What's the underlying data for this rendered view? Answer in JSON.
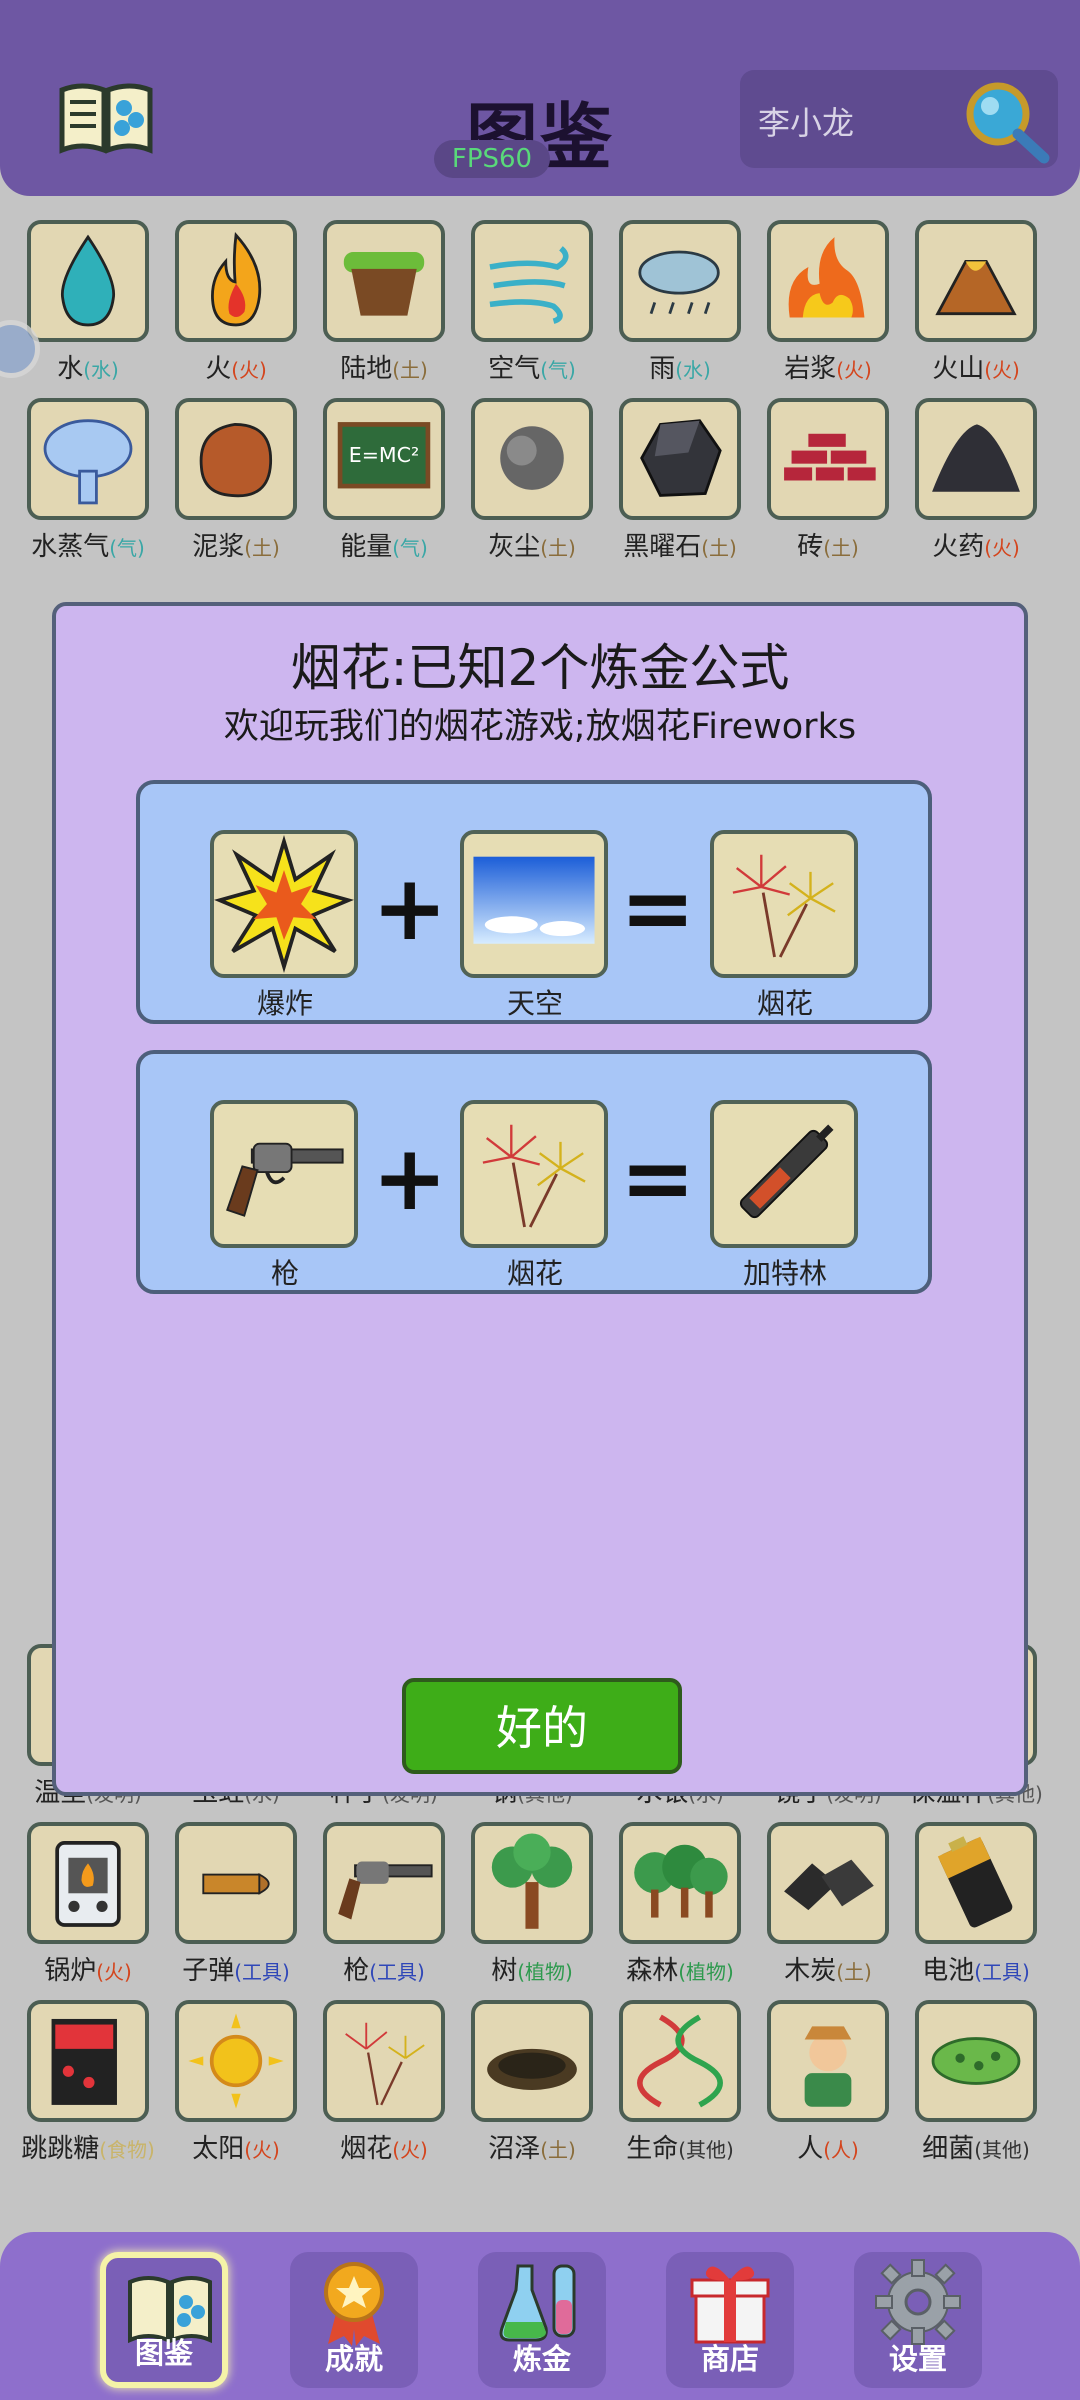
{
  "header": {
    "title": "图鉴",
    "fps": "FPS60",
    "search_text": "李小龙"
  },
  "grid": [
    {
      "name": "水",
      "cat": "水",
      "color": "#3aa7a6",
      "icon": "water-drop-icon"
    },
    {
      "name": "火",
      "cat": "火",
      "color": "#d4451d",
      "icon": "fire-icon"
    },
    {
      "name": "陆地",
      "cat": "土",
      "color": "#8a6d3b",
      "icon": "land-icon"
    },
    {
      "name": "空气",
      "cat": "气",
      "color": "#3aa7a6",
      "icon": "wind-icon"
    },
    {
      "name": "雨",
      "cat": "水",
      "color": "#3aa7a6",
      "icon": "rain-cloud-icon"
    },
    {
      "name": "岩浆",
      "cat": "火",
      "color": "#d4451d",
      "icon": "lava-icon"
    },
    {
      "name": "火山",
      "cat": "火",
      "color": "#d4451d",
      "icon": "volcano-icon"
    },
    {
      "name": "水蒸气",
      "cat": "气",
      "color": "#3aa7a6",
      "icon": "steam-icon"
    },
    {
      "name": "泥浆",
      "cat": "土",
      "color": "#8a6d3b",
      "icon": "mud-icon"
    },
    {
      "name": "能量",
      "cat": "气",
      "color": "#3aa7a6",
      "icon": "energy-board-icon"
    },
    {
      "name": "灰尘",
      "cat": "土",
      "color": "#8a6d3b",
      "icon": "dust-icon"
    },
    {
      "name": "黑曜石",
      "cat": "土",
      "color": "#8a6d3b",
      "icon": "obsidian-icon"
    },
    {
      "name": "砖",
      "cat": "土",
      "color": "#8a6d3b",
      "icon": "brick-icon"
    },
    {
      "name": "火药",
      "cat": "火",
      "color": "#d4451d",
      "icon": "gunpowder-icon"
    },
    {
      "name": "锅炉",
      "cat": "火",
      "color": "#d4451d",
      "icon": "boiler-icon"
    },
    {
      "name": "子弹",
      "cat": "工具",
      "color": "#2f47b8",
      "icon": "bullet-icon"
    },
    {
      "name": "枪",
      "cat": "工具",
      "color": "#2f47b8",
      "icon": "revolver-icon"
    },
    {
      "name": "树",
      "cat": "植物",
      "color": "#2e9a4e",
      "icon": "tree-icon"
    },
    {
      "name": "森林",
      "cat": "植物",
      "color": "#2e9a4e",
      "icon": "forest-icon"
    },
    {
      "name": "木炭",
      "cat": "土",
      "color": "#8a6d3b",
      "icon": "charcoal-icon"
    },
    {
      "name": "电池",
      "cat": "工具",
      "color": "#2f47b8",
      "icon": "battery-icon"
    },
    {
      "name": "跳跳糖",
      "cat": "食物",
      "color": "#c9b46a",
      "icon": "pop-rocks-icon"
    },
    {
      "name": "太阳",
      "cat": "火",
      "color": "#d4451d",
      "icon": "sun-icon"
    },
    {
      "name": "烟花",
      "cat": "火",
      "color": "#d4451d",
      "icon": "fireworks-icon"
    },
    {
      "name": "沼泽",
      "cat": "土",
      "color": "#8a6d3b",
      "icon": "swamp-icon"
    },
    {
      "name": "生命",
      "cat": "其他",
      "color": "#333333",
      "icon": "dna-icon"
    },
    {
      "name": "人",
      "cat": "人",
      "color": "#d4451d",
      "icon": "person-icon"
    },
    {
      "name": "细菌",
      "cat": "其他",
      "color": "#333333",
      "icon": "bacteria-icon"
    }
  ],
  "partial_row_labels": [
    {
      "name": "温室",
      "cat": "发明"
    },
    {
      "name": "玉蛀",
      "cat": "水"
    },
    {
      "name": "杯子",
      "cat": "发明"
    },
    {
      "name": "钢",
      "cat": "其他"
    },
    {
      "name": "水银",
      "cat": "水"
    },
    {
      "name": "镜子",
      "cat": "发明"
    },
    {
      "name": "保温杯",
      "cat": "其他"
    }
  ],
  "modal": {
    "title": "烟花:已知2个炼金公式",
    "subtitle": "欢迎玩我们的烟花游戏;放烟花Fireworks",
    "recipes": [
      {
        "a": "爆炸",
        "b": "天空",
        "result": "烟花"
      },
      {
        "a": "枪",
        "b": "烟花",
        "result": "加特林"
      }
    ],
    "ok_label": "好的"
  },
  "nav": {
    "items": [
      {
        "label": "图鉴",
        "icon": "book-icon",
        "active": true
      },
      {
        "label": "成就",
        "icon": "medal-icon",
        "active": false
      },
      {
        "label": "炼金",
        "icon": "flask-icon",
        "active": false
      },
      {
        "label": "商店",
        "icon": "gift-icon",
        "active": false
      },
      {
        "label": "设置",
        "icon": "gear-icon",
        "active": false
      }
    ]
  },
  "colors": {
    "header": "#6e57a3",
    "modal_bg": "#cdb6ef",
    "recipe_bg": "#a8c6f7",
    "ok_button": "#3ead18",
    "bottom_bar": "#8e6fcc"
  }
}
